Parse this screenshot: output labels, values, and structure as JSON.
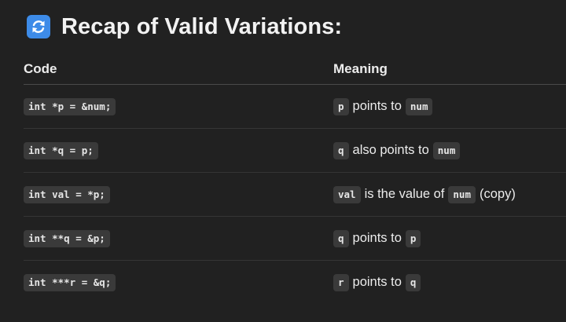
{
  "heading": {
    "icon": "counterclockwise-arrows-icon",
    "text": "Recap of Valid Variations:"
  },
  "table": {
    "columns": [
      "Code",
      "Meaning"
    ],
    "rows": [
      {
        "code": "int *p = &num;",
        "meaning": [
          [
            "code",
            "p"
          ],
          [
            "text",
            "points to"
          ],
          [
            "code",
            "num"
          ]
        ]
      },
      {
        "code": "int *q = p;",
        "meaning": [
          [
            "code",
            "q"
          ],
          [
            "text",
            "also points to"
          ],
          [
            "code",
            "num"
          ]
        ]
      },
      {
        "code": "int val = *p;",
        "meaning": [
          [
            "code",
            "val"
          ],
          [
            "text",
            "is the value of"
          ],
          [
            "code",
            "num"
          ],
          [
            "text",
            "(copy)"
          ]
        ]
      },
      {
        "code": "int **q = &p;",
        "meaning": [
          [
            "code",
            "q"
          ],
          [
            "text",
            "points to"
          ],
          [
            "code",
            "p"
          ]
        ]
      },
      {
        "code": "int ***r = &q;",
        "meaning": [
          [
            "code",
            "r"
          ],
          [
            "text",
            "points to"
          ],
          [
            "code",
            "q"
          ]
        ]
      }
    ]
  },
  "colors": {
    "background": "#212121",
    "icon_bg": "#3d8be8",
    "code_bg": "#3a3a3a"
  }
}
